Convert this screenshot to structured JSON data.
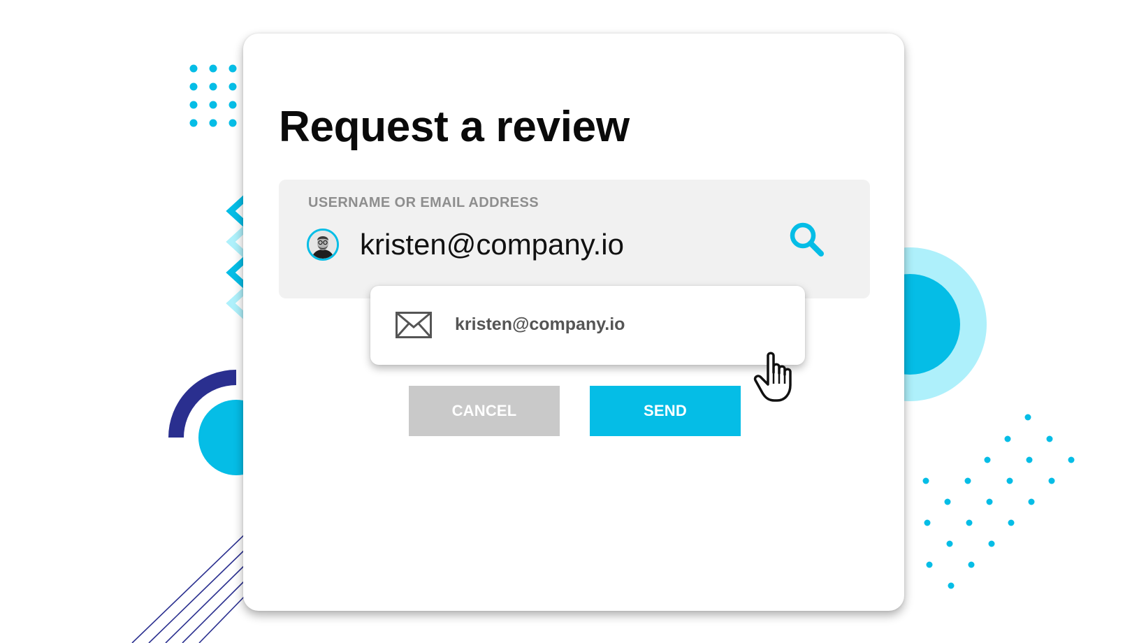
{
  "dialog": {
    "title": "Request a review",
    "field": {
      "label": "USERNAME OR EMAIL ADDRESS",
      "value": "kristen@company.io",
      "avatar_icon": "user-avatar",
      "search_icon": "search-icon"
    },
    "suggestion": {
      "icon": "mail-icon",
      "text": "kristen@company.io"
    },
    "buttons": {
      "cancel_label": "CANCEL",
      "send_label": "SEND"
    }
  },
  "colors": {
    "accent": "#05bde6",
    "accent_light": "#aef0fb",
    "navy": "#2a2f8f",
    "field_bg": "#f1f1f1",
    "cancel_bg": "#c9c9c9"
  },
  "cursor_icon": "hand-pointer-icon"
}
